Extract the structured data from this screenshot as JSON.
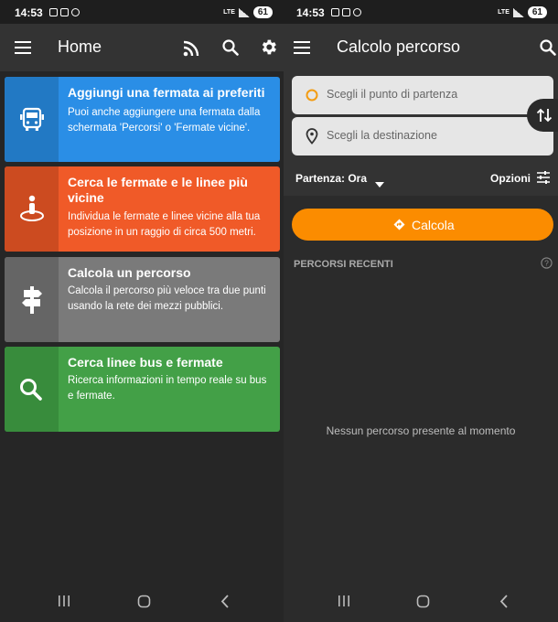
{
  "status_left": {
    "time": "14:53",
    "network": "LTE",
    "battery": "61"
  },
  "status_right": {
    "time": "14:53",
    "network": "LTE",
    "battery": "61"
  },
  "home": {
    "title": "Home",
    "cards": [
      {
        "title": "Aggiungi una fermata ai preferiti",
        "desc": "Puoi anche aggiungere una fermata dalla schermata 'Percorsi' o 'Fermate vicine'.",
        "icon": "bus-icon",
        "color": "#2a8ee6",
        "strip": "#2279c4"
      },
      {
        "title": "Cerca le fermate e le linee più vicine",
        "desc": "Individua le fermate e linee vicine alla tua posizione in un raggio di circa 500 metri.",
        "icon": "person-location-icon",
        "color": "#f05a28",
        "strip": "#cc4b20"
      },
      {
        "title": "Calcola un percorso",
        "desc": "Calcola il percorso più veloce tra due punti usando la rete dei mezzi pubblici.",
        "icon": "signpost-icon",
        "color": "#7a7a7a",
        "strip": "#656565"
      },
      {
        "title": "Cerca linee bus e fermate",
        "desc": "Ricerca informazioni in tempo reale su bus e fermate.",
        "icon": "search-icon",
        "color": "#43a047",
        "strip": "#388c3c"
      }
    ]
  },
  "route": {
    "title": "Calcolo percorso",
    "start_placeholder": "Scegli il punto di partenza",
    "dest_placeholder": "Scegli la destinazione",
    "departure_label": "Partenza: Ora",
    "options_label": "Opzioni",
    "calc_label": "Calcola",
    "recent_header": "PERCORSI RECENTI",
    "empty_message": "Nessun percorso presente al momento"
  },
  "colors": {
    "accent_orange": "#fb8c00",
    "appbar": "#333333",
    "background": "#262626"
  }
}
